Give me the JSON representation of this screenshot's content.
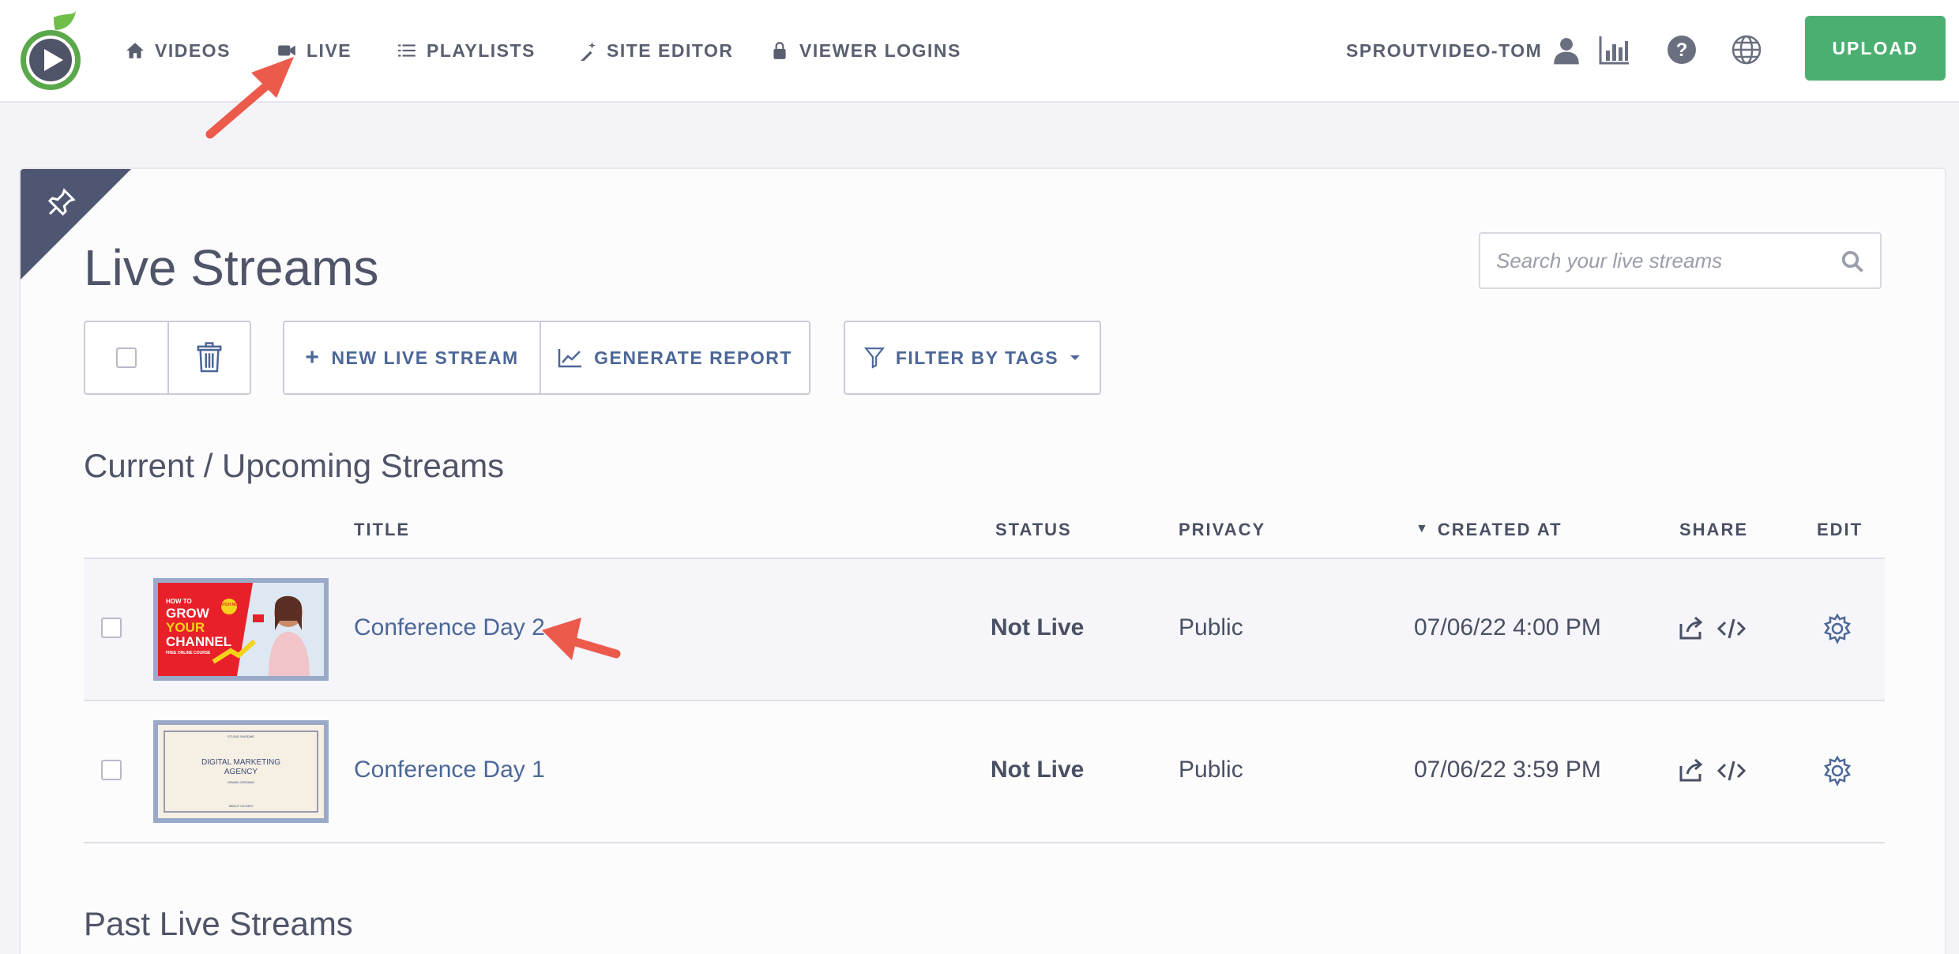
{
  "nav": {
    "items": [
      {
        "label": "VIDEOS",
        "icon": "home-icon"
      },
      {
        "label": "LIVE",
        "icon": "video-camera-icon"
      },
      {
        "label": "PLAYLISTS",
        "icon": "list-icon"
      },
      {
        "label": "SITE EDITOR",
        "icon": "magic-wand-icon"
      },
      {
        "label": "VIEWER LOGINS",
        "icon": "lock-icon"
      }
    ],
    "account": "SPROUTVIDEO-TOM",
    "upload_label": "UPLOAD"
  },
  "page": {
    "title": "Live Streams",
    "search_placeholder": "Search your live streams"
  },
  "toolbar": {
    "new_label": "NEW LIVE STREAM",
    "report_label": "GENERATE REPORT",
    "filter_label": "FILTER BY TAGS"
  },
  "sections": {
    "current": "Current / Upcoming Streams",
    "past": "Past Live Streams"
  },
  "table": {
    "columns": [
      "TITLE",
      "STATUS",
      "PRIVACY",
      "CREATED AT",
      "SHARE",
      "EDIT"
    ],
    "sort_indicator": "▼",
    "rows": [
      {
        "title": "Conference Day 2",
        "status": "Not Live",
        "privacy": "Public",
        "created": "07/06/22 4:00 PM",
        "thumb": {
          "line1": "HOW TO",
          "line2": "GROW",
          "line3": "YOUR",
          "line4": "CHANNEL",
          "line5": "FREE ONLINE COURSE",
          "badge": "WATCH NOW"
        }
      },
      {
        "title": "Conference Day 1",
        "status": "Not Live",
        "privacy": "Public",
        "created": "07/06/22 3:59 PM",
        "thumb": {
          "top": "STUDIO SHODWE",
          "main1": "DIGITAL MARKETING",
          "main2": "AGENCY",
          "sub": "GRAND OPENING",
          "footer": "ABOUT US INFO"
        }
      }
    ]
  },
  "colors": {
    "brand_green": "#4caf72",
    "link_blue": "#4c6797",
    "corner_navy": "#4f5671",
    "annotation_red": "#ec5a4b"
  }
}
